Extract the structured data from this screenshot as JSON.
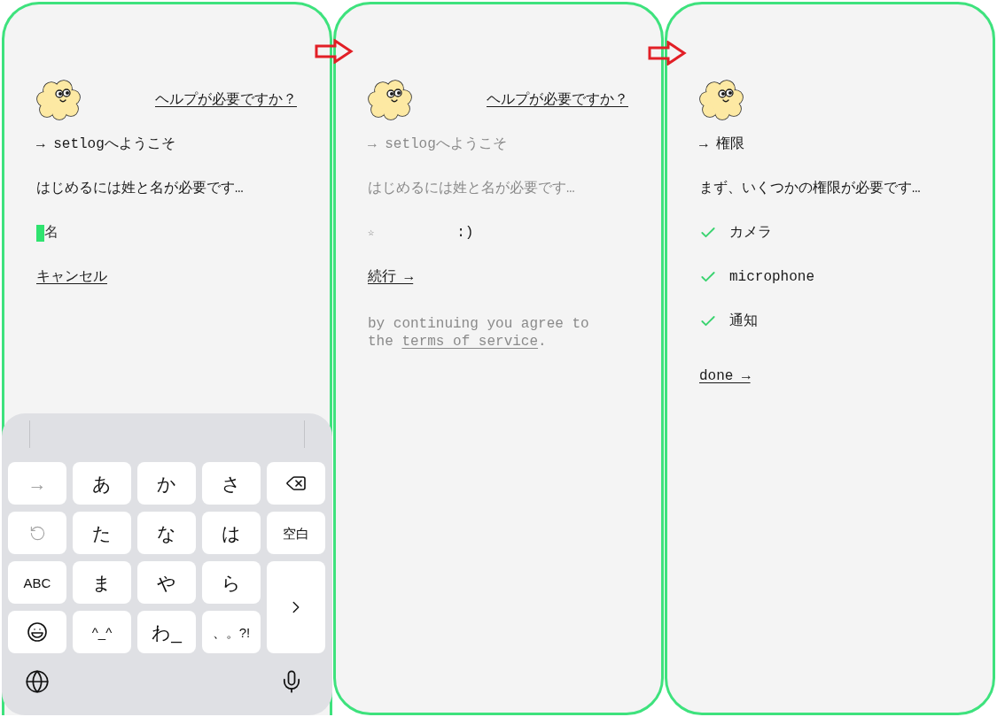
{
  "screens": [
    {
      "help_link": "ヘルプが必要ですか？",
      "heading": {
        "text": "→ setlogへようこそ",
        "dimmed": false
      },
      "prompt": {
        "text": "はじめるには姓と名が必要です…",
        "dimmed": false
      },
      "name_field": {
        "placeholder": "名",
        "focused": true
      },
      "action_link": "キャンセル",
      "keyboard": {
        "keys": [
          {
            "kind": "kana",
            "label": "→",
            "disabled": true
          },
          {
            "kind": "kana",
            "label": "あ",
            "disabled": false
          },
          {
            "kind": "kana",
            "label": "か",
            "disabled": false
          },
          {
            "kind": "kana",
            "label": "さ",
            "disabled": false
          },
          {
            "kind": "backspace",
            "disabled": false
          },
          {
            "kind": "undo",
            "disabled": true
          },
          {
            "kind": "kana",
            "label": "た",
            "disabled": false
          },
          {
            "kind": "kana",
            "label": "な",
            "disabled": false
          },
          {
            "kind": "kana",
            "label": "は",
            "disabled": false
          },
          {
            "kind": "label",
            "label": "空白",
            "disabled": false
          },
          {
            "kind": "label",
            "label": "ABC",
            "disabled": false
          },
          {
            "kind": "kana",
            "label": "ま",
            "disabled": false
          },
          {
            "kind": "kana",
            "label": "や",
            "disabled": false
          },
          {
            "kind": "kana",
            "label": "ら",
            "disabled": false
          },
          {
            "kind": "next",
            "disabled": false
          },
          {
            "kind": "emoji",
            "disabled": false
          },
          {
            "kind": "label",
            "label": "^_^",
            "disabled": false
          },
          {
            "kind": "kana",
            "label": "わ_",
            "disabled": false
          },
          {
            "kind": "label",
            "label": "、。?!",
            "disabled": false
          }
        ]
      }
    },
    {
      "help_link": "ヘルプが必要ですか？",
      "heading": {
        "text": "→ setlogへようこそ",
        "dimmed": true
      },
      "prompt": {
        "text": "はじめるには姓と名が必要です…",
        "dimmed": true
      },
      "name_row": {
        "marker": "☆",
        "text": ":)"
      },
      "action_link": "続行 →",
      "terms": {
        "text": "by continuing you agree to the",
        "link": "terms of service",
        "end": "."
      }
    },
    {
      "heading": {
        "text": "→ 権限",
        "dimmed": false
      },
      "prompt": {
        "text": "まず、いくつかの権限が必要です…",
        "dimmed": false
      },
      "permissions": [
        {
          "label": "カメラ",
          "granted": true
        },
        {
          "label": "microphone",
          "granted": true
        },
        {
          "label": "通知",
          "granted": true
        }
      ],
      "action_link": "done →"
    }
  ]
}
